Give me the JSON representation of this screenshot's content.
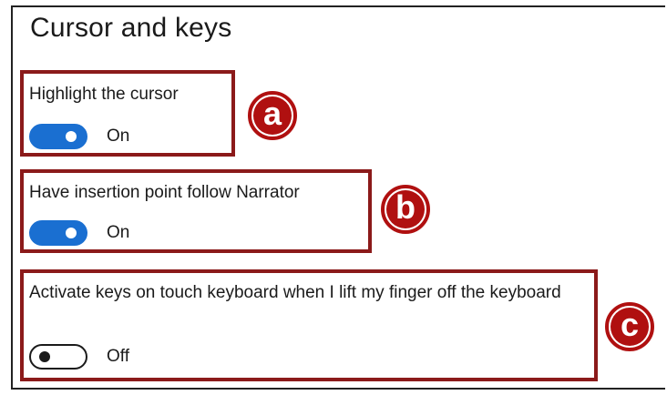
{
  "section": {
    "title": "Cursor and keys"
  },
  "settings": [
    {
      "label": "Highlight the cursor",
      "state": "On",
      "enabled": true,
      "marker": "a"
    },
    {
      "label": "Have insertion point follow Narrator",
      "state": "On",
      "enabled": true,
      "marker": "b"
    },
    {
      "label": "Activate keys on touch keyboard when I lift my finger off the keyboard",
      "state": "Off",
      "enabled": false,
      "marker": "c"
    }
  ],
  "colors": {
    "annotation_border": "#8b1a1a",
    "marker": "#b01010",
    "toggle_on": "#1a6fd1",
    "text": "#1a1a1a"
  }
}
